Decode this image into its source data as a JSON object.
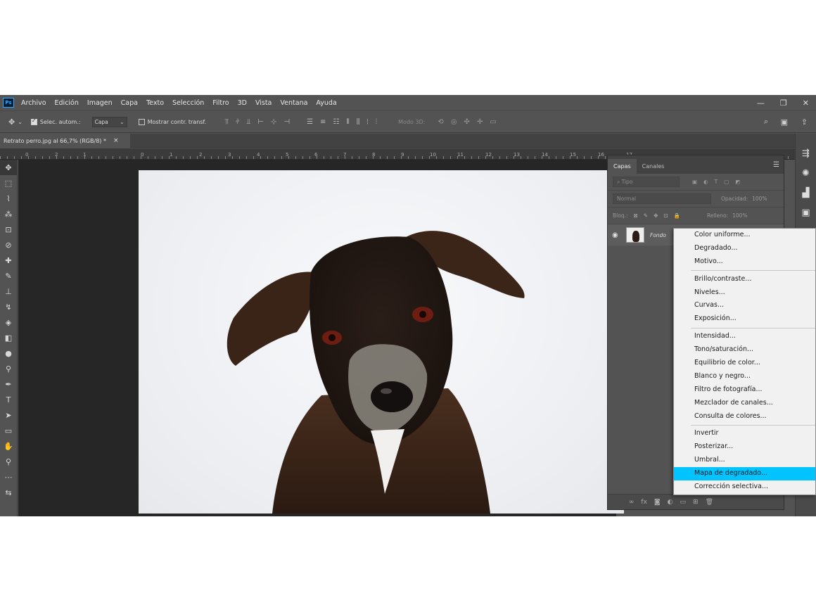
{
  "app": {
    "logo": "Ps",
    "menus": [
      "Archivo",
      "Edición",
      "Imagen",
      "Capa",
      "Texto",
      "Selección",
      "Filtro",
      "3D",
      "Vista",
      "Ventana",
      "Ayuda"
    ],
    "window_controls": [
      "—",
      "❐",
      "✕"
    ]
  },
  "options": {
    "auto_select_label": "Selec. autom.:",
    "auto_select_value": "Capa",
    "show_transform_label": "Mostrar contr. transf.",
    "mode_3d_label": "Modo 3D:"
  },
  "document": {
    "tab_title": "Retrato perro.jpg al 66,7% (RGB/8) *",
    "close_glyph": "×"
  },
  "ruler": {
    "ticks": [
      "0",
      "2",
      "1",
      "0",
      "1",
      "2",
      "3",
      "4",
      "5",
      "6",
      "7",
      "8",
      "9",
      "10",
      "11",
      "12",
      "13",
      "14",
      "15",
      "16",
      "17"
    ]
  },
  "layers_panel": {
    "tabs": [
      "Capas",
      "Canales"
    ],
    "filter_placeholder": "Tipo",
    "blend_mode": "Normal",
    "opacity_label": "Opacidad:",
    "opacity_value": "100%",
    "lock_label": "Bloq.:",
    "fill_label": "Relleno:",
    "fill_value": "100%",
    "layer_name": "Fondo"
  },
  "adjustment_menu": {
    "groups": [
      [
        "Color uniforme...",
        "Degradado...",
        "Motivo..."
      ],
      [
        "Brillo/contraste...",
        "Niveles...",
        "Curvas...",
        "Exposición..."
      ],
      [
        "Intensidad...",
        "Tono/saturación...",
        "Equilibrio de color...",
        "Blanco y negro...",
        "Filtro de fotografía...",
        "Mezclador de canales...",
        "Consulta de colores..."
      ],
      [
        "Invertir",
        "Posterizar...",
        "Umbral...",
        "Mapa de degradado...",
        "Corrección selectiva..."
      ]
    ],
    "highlighted": "Mapa de degradado..."
  },
  "colors": {
    "ui_background": "#535353",
    "canvas_background": "#262626",
    "menu_highlight": "#00c3ff"
  }
}
